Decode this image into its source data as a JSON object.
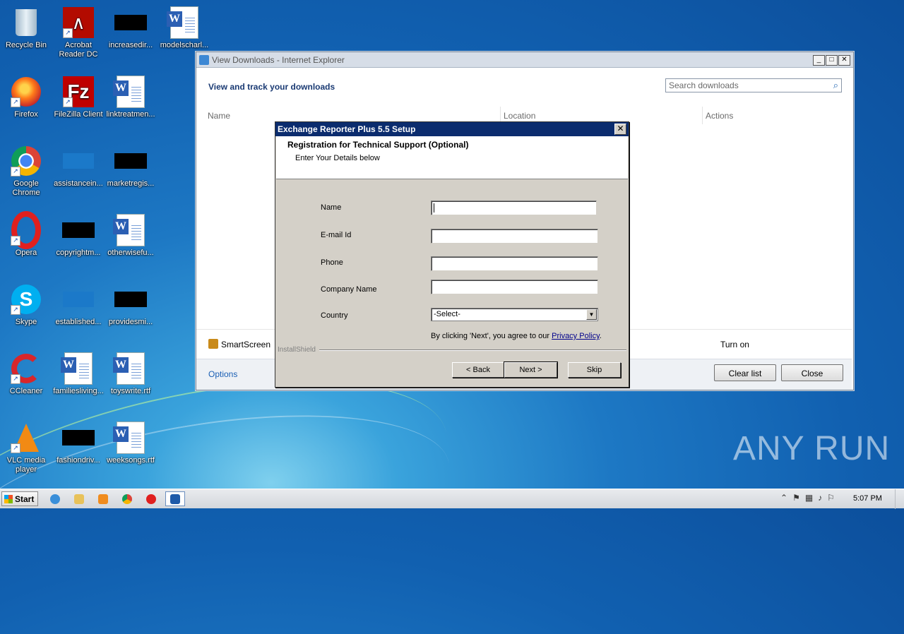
{
  "desktop": {
    "icons": [
      {
        "label": "Recycle Bin",
        "icon": "recycle-bin-icon"
      },
      {
        "label": "Acrobat Reader DC",
        "icon": "acrobat-icon"
      },
      {
        "label": "increasedir...",
        "icon": "redacted-file-icon"
      },
      {
        "label": "modelscharl...",
        "icon": "word-doc-icon"
      },
      {
        "label": "Firefox",
        "icon": "firefox-icon"
      },
      {
        "label": "FileZilla Client",
        "icon": "filezilla-icon"
      },
      {
        "label": "linktreatmen...",
        "icon": "word-doc-icon"
      },
      {
        "label": "Google Chrome",
        "icon": "chrome-icon"
      },
      {
        "label": "assistancein...",
        "icon": "file-icon"
      },
      {
        "label": "marketregis...",
        "icon": "redacted-file-icon"
      },
      {
        "label": "Opera",
        "icon": "opera-icon"
      },
      {
        "label": "copyrightm...",
        "icon": "redacted-file-icon"
      },
      {
        "label": "otherwisefu...",
        "icon": "word-doc-icon"
      },
      {
        "label": "Skype",
        "icon": "skype-icon"
      },
      {
        "label": "established...",
        "icon": "file-icon"
      },
      {
        "label": "providesmi...",
        "icon": "redacted-file-icon"
      },
      {
        "label": "CCleaner",
        "icon": "ccleaner-icon"
      },
      {
        "label": "familiesliving...",
        "icon": "word-doc-icon"
      },
      {
        "label": "toyswrite.rtf",
        "icon": "word-doc-icon"
      },
      {
        "label": "VLC media player",
        "icon": "vlc-icon"
      },
      {
        "label": "fashiondriv...",
        "icon": "redacted-file-icon"
      },
      {
        "label": "weeksongs.rtf",
        "icon": "word-doc-icon"
      }
    ],
    "watermark": "ANY RUN"
  },
  "ie_window": {
    "title": "View Downloads - Internet Explorer",
    "heading": "View and track your downloads",
    "search_placeholder": "Search downloads",
    "columns": [
      "Name",
      "Location",
      "Actions"
    ],
    "smartscreen": "SmartScreen",
    "turn_on": "Turn on",
    "options": "Options",
    "clear_list": "Clear list",
    "close": "Close"
  },
  "setup_dialog": {
    "title": "Exchange Reporter Plus 5.5 Setup",
    "header_title": "Registration for Technical Support (Optional)",
    "header_subtitle": "Enter Your Details below",
    "fields": {
      "name": "Name",
      "email": "E-mail Id",
      "phone": "Phone",
      "company": "Company Name",
      "country": "Country"
    },
    "country_value": "-Select-",
    "agree_text": "By clicking 'Next', you agree to our ",
    "privacy_link": "Privacy Policy",
    "agree_end": ".",
    "installshield": "InstallShield",
    "back": "< Back",
    "next": "Next >",
    "skip": "Skip"
  },
  "taskbar": {
    "start": "Start",
    "clock": "5:07 PM"
  }
}
